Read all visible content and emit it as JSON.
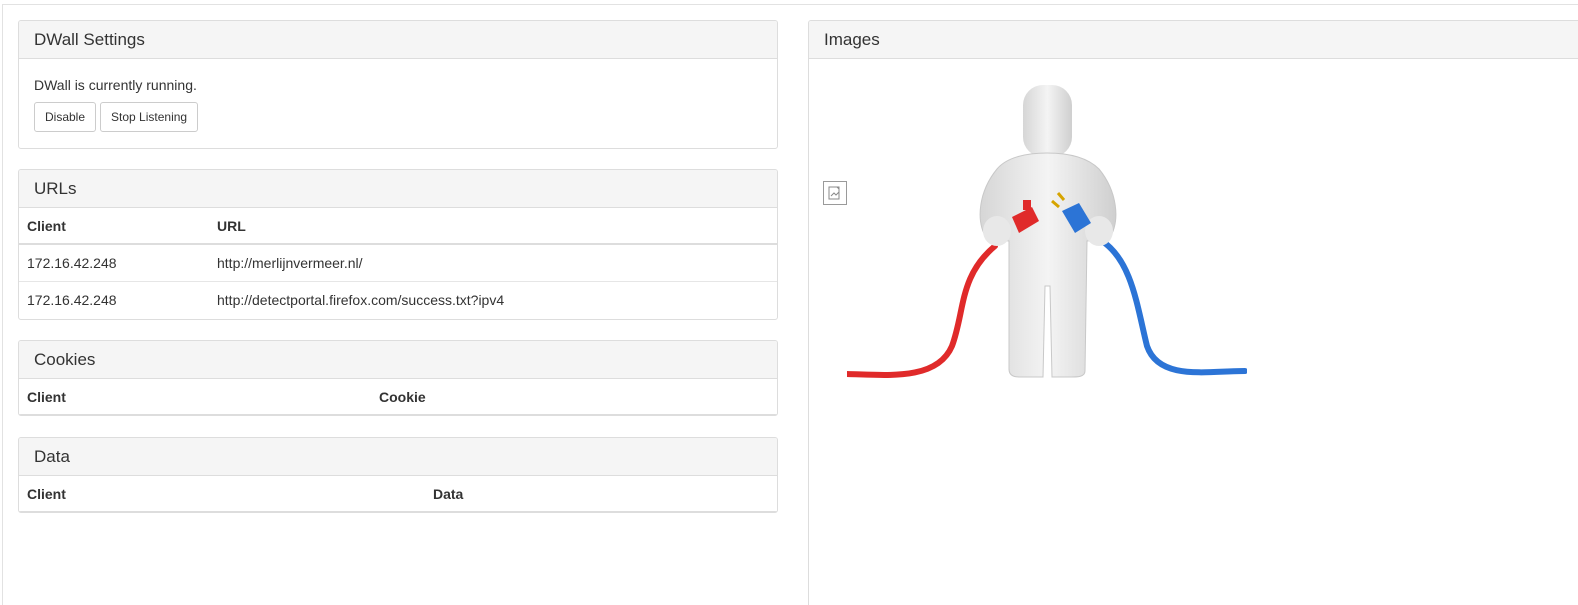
{
  "settings": {
    "title": "DWall Settings",
    "status_text": "DWall is currently running.",
    "disable_label": "Disable",
    "stop_label": "Stop Listening"
  },
  "urls": {
    "title": "URLs",
    "headers": [
      "Client",
      "URL"
    ],
    "rows": [
      [
        "172.16.42.248",
        "http://merlijnvermeer.nl/"
      ],
      [
        "172.16.42.248",
        "http://detectportal.firefox.com/success.txt?ipv4"
      ]
    ]
  },
  "cookies": {
    "title": "Cookies",
    "headers": [
      "Client",
      "Cookie"
    ]
  },
  "data_panel": {
    "title": "Data",
    "headers": [
      "Client",
      "Data"
    ]
  },
  "images": {
    "title": "Images",
    "broken_icon": "broken-image-icon",
    "illustration": "figure-holding-red-and-blue-plugs"
  },
  "colors": {
    "panel_heading_bg": "#f5f5f5",
    "border": "#dddddd",
    "cable_red": "#e02a2a",
    "cable_blue": "#2c74d6"
  }
}
